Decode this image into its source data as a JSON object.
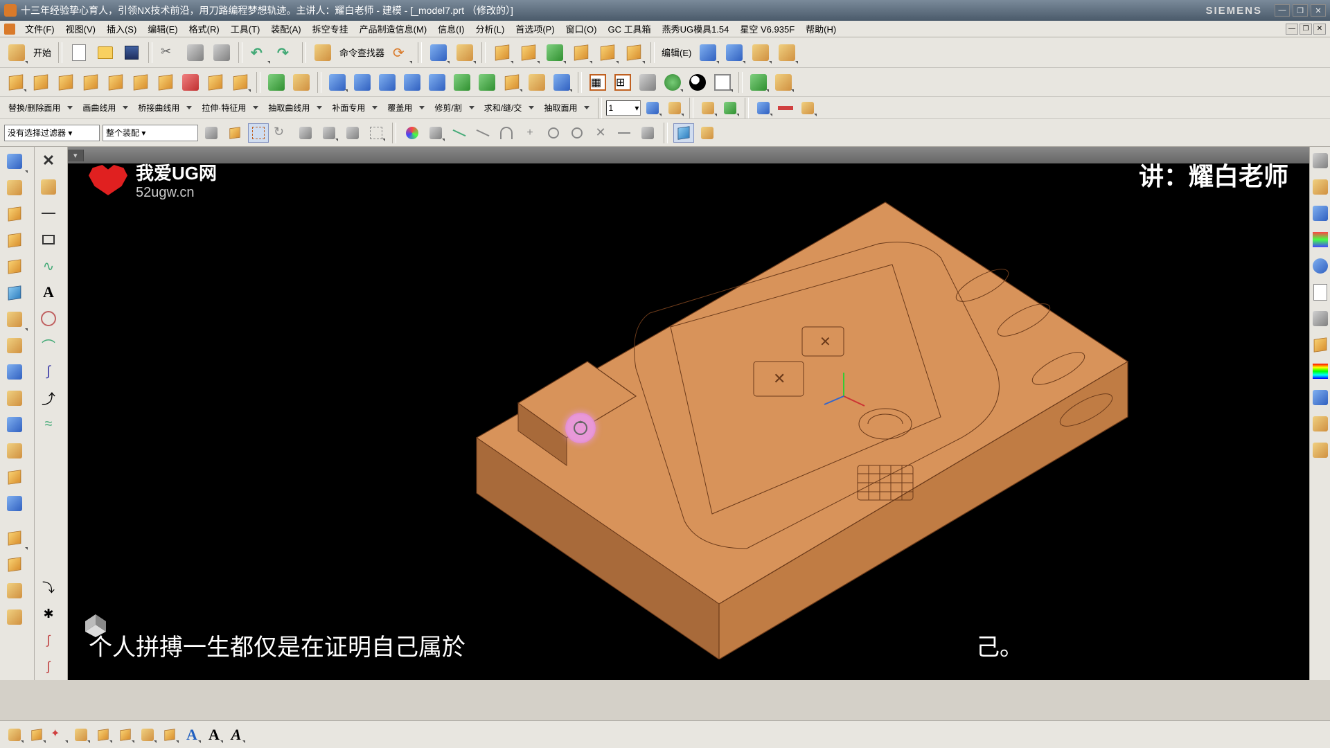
{
  "titlebar": {
    "title": "十三年经验挚心育人，引领NX技术前沿，用刀路编程梦想轨迹。主讲人：耀白老师 - 建模 - [_model7.prt （修改的）]",
    "brand": "SIEMENS"
  },
  "menu": {
    "items": [
      "文件(F)",
      "视图(V)",
      "插入(S)",
      "编辑(E)",
      "格式(R)",
      "工具(T)",
      "装配(A)",
      "拆空专挂",
      "产品制造信息(M)",
      "信息(I)",
      "分析(L)",
      "首选项(P)",
      "窗口(O)",
      "GC 工具箱",
      "燕秀UG模具1.54",
      "星空 V6.935F",
      "帮助(H)"
    ]
  },
  "toolbar1": {
    "start_label": "开始",
    "cmd_finder": "命令查找器"
  },
  "row3_groups": [
    "替换/删除面用",
    "画曲线用",
    "桥接曲线用",
    "拉伸·特征用",
    "抽取曲线用",
    "补面专用",
    "覆盖用",
    "修剪/割",
    "求和/缝/交",
    "抽取面用"
  ],
  "row3_number": "1",
  "filterbar": {
    "sel1": "没有选择过滤器",
    "sel2": "整个装配"
  },
  "watermark": {
    "site_zh": "我爱UG网",
    "site_url": "52ugw.cn",
    "presenter": "讲：耀白老师",
    "quote_left": "个人拼搏一生都仅是在证明自己属於",
    "quote_right": "己。"
  },
  "right_rail_items": [
    "part-nav",
    "assembly-nav",
    "constraint-nav",
    "layers",
    "info",
    "history",
    "materials",
    "render",
    "analysis",
    "roles",
    "preferences",
    "help"
  ]
}
